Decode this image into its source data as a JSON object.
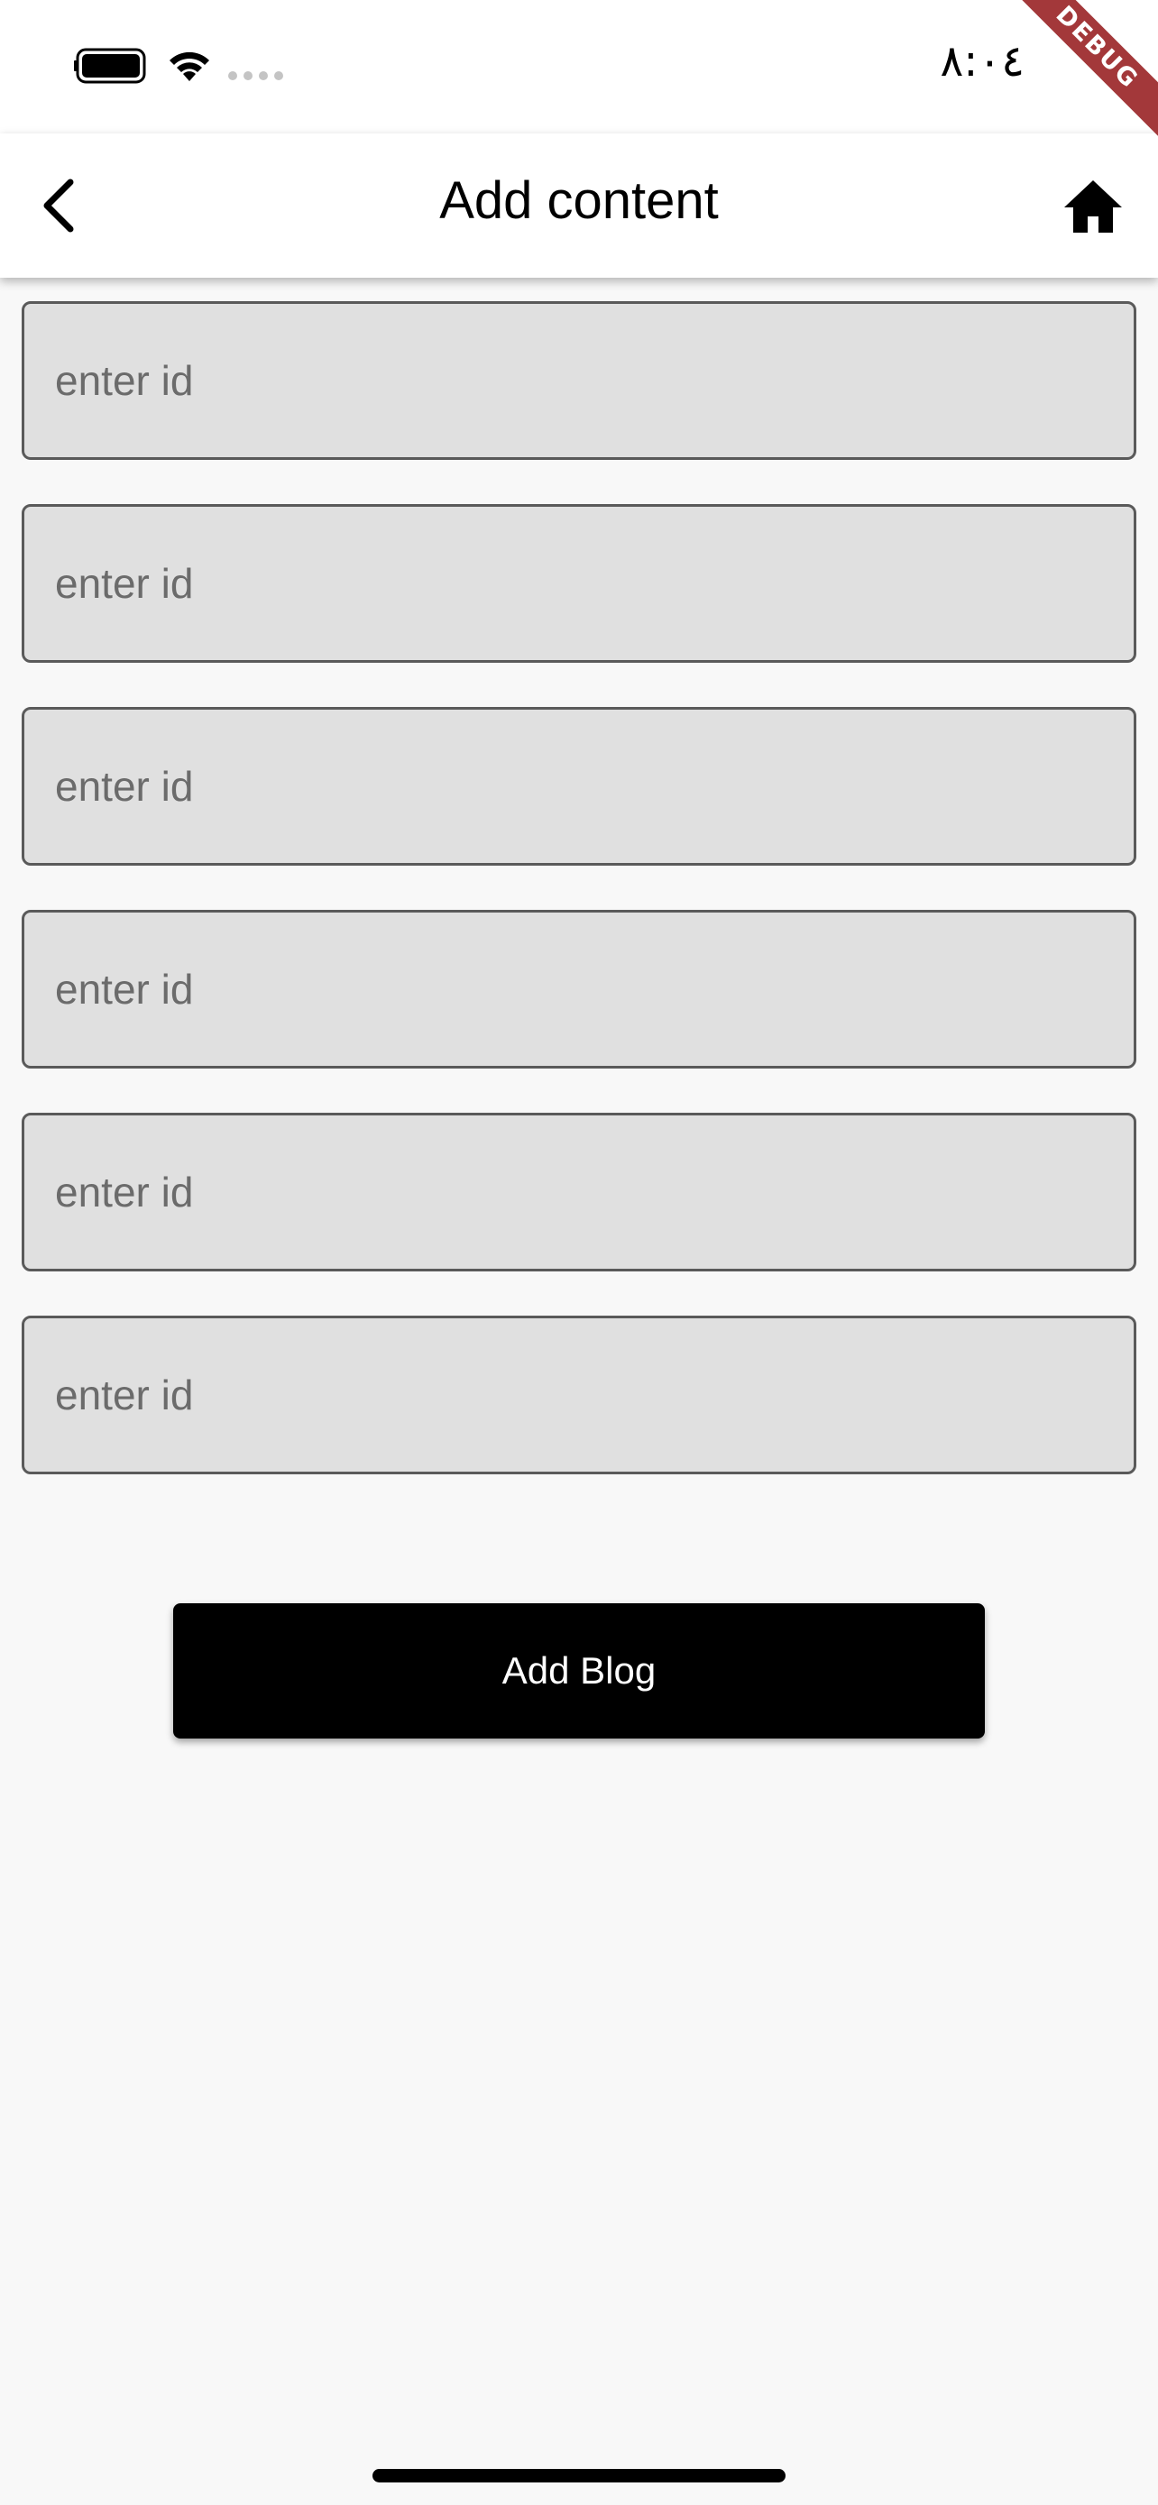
{
  "status_bar": {
    "time": "٨:٠٤",
    "debug_banner": "DEBUG",
    "icons": [
      "battery-icon",
      "wifi-icon",
      "signal-dots-icon"
    ]
  },
  "app_bar": {
    "title": "Add content",
    "back_icon": "chevron-left-icon",
    "home_icon": "home-icon"
  },
  "form": {
    "fields": [
      {
        "placeholder": "enter id",
        "value": ""
      },
      {
        "placeholder": "enter id",
        "value": ""
      },
      {
        "placeholder": "enter id",
        "value": ""
      },
      {
        "placeholder": "enter id",
        "value": ""
      },
      {
        "placeholder": "enter id",
        "value": ""
      },
      {
        "placeholder": "enter id",
        "value": ""
      }
    ],
    "submit_label": "Add Blog"
  },
  "colors": {
    "app_bar_bg": "#ffffff",
    "page_bg": "#f8f8f8",
    "field_bg": "#e0e0e0",
    "field_border": "#5a5a5a",
    "button_bg": "#000000",
    "button_text": "#ffffff",
    "debug_banner": "#a3383a"
  }
}
